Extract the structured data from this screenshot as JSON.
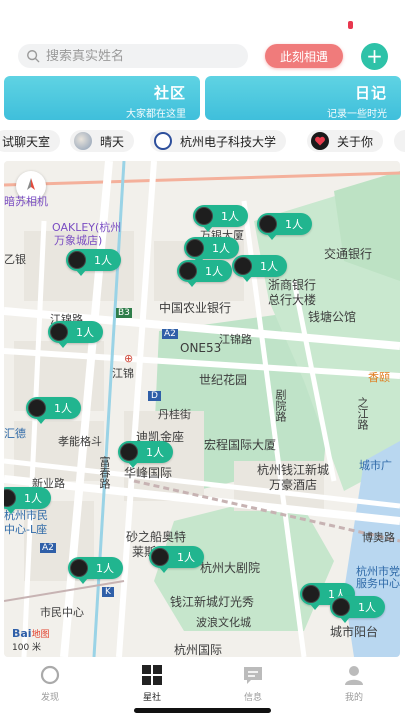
{
  "search": {
    "placeholder": "搜索真实姓名"
  },
  "header": {
    "moment_label": "此刻相遇",
    "add_label": "+"
  },
  "cards": [
    {
      "title": "社区",
      "subtitle": "大家都在这里"
    },
    {
      "title": "日记",
      "subtitle": "记录一些时光"
    }
  ],
  "tags": [
    {
      "label": "试聊天室"
    },
    {
      "label": "晴天"
    },
    {
      "label": "杭州电子科技大学"
    },
    {
      "label": "关于你"
    }
  ],
  "map": {
    "scale_label": "100 米",
    "logo_label": "Bai",
    "logo_suffix": "地图",
    "labels": {
      "l1": "暗苏相机",
      "l2": "OAKLEY(杭州",
      "l3": "万象城店)",
      "l4": "万银大厦",
      "l5": "交通银行",
      "l6": "浙商银行",
      "l7": "总行大楼",
      "l8": "钱塘公馆",
      "l9": "中国农业银行",
      "l10": "江锦路",
      "l11": "ONE53",
      "l12": "江锦路",
      "l13": "世纪花园",
      "l14": "丹桂街",
      "l15": "剧院路",
      "l16": "之江路",
      "l17": "香颐",
      "l18": "迪凯金座",
      "l19": "宏程国际大厦",
      "l20": "华峰国际",
      "l21": "杭州钱江新城",
      "l22": "万豪酒店",
      "l23": "城市阳台",
      "l24": "砂之船奥特",
      "l25": "莱斯",
      "l26": "杭州大剧院",
      "l27": "钱江新城灯光秀",
      "l28": "波浪文化城",
      "l29": "杭州国际",
      "l30": "市民中心",
      "l31": "杭州市民",
      "l32": "中心-L座",
      "l33": "新业路",
      "l34": "富春路",
      "l35": "博奥路",
      "l36": "杭州市党",
      "l37": "服务中心",
      "l38": "城市阳台",
      "l39": "孝能格斗",
      "l40": "汇德",
      "l41": "B3",
      "l42": "A2",
      "l43": "D",
      "l44": "A2",
      "l45": "K",
      "l46": "江锦",
      "l47": "乙银",
      "l48": "城市广"
    },
    "pins": [
      {
        "label": "1人"
      },
      {
        "label": "1人"
      },
      {
        "label": "1人"
      },
      {
        "label": "1人"
      },
      {
        "label": "1人"
      },
      {
        "label": "1人"
      },
      {
        "label": "1人"
      },
      {
        "label": "1人"
      },
      {
        "label": "1人"
      },
      {
        "label": "1人"
      },
      {
        "label": "1人"
      },
      {
        "label": "1人"
      },
      {
        "label": "1人"
      },
      {
        "label": "1人"
      },
      {
        "label": "1人"
      }
    ]
  },
  "tabbar": [
    {
      "label": "发现"
    },
    {
      "label": "星社"
    },
    {
      "label": "信息"
    },
    {
      "label": "我的"
    }
  ],
  "colors": {
    "accent": "#2ec2a8",
    "pin": "#21b58f",
    "moment": "#f07b7b",
    "card": "#4fc8df"
  }
}
